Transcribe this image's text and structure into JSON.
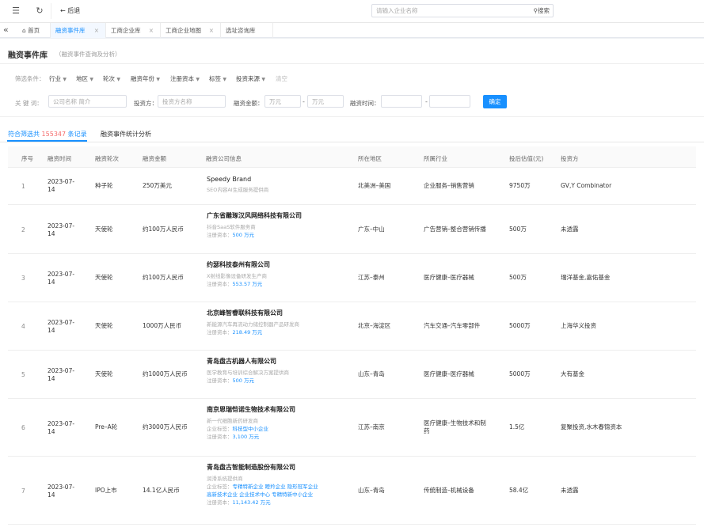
{
  "topbar": {
    "back_label": "后退",
    "search_placeholder": "请输入企业名称",
    "search_button": "搜索"
  },
  "tabs": [
    {
      "label": "首页",
      "closable": false
    },
    {
      "label": "融资事件库",
      "closable": true,
      "active": true
    },
    {
      "label": "工商企业库",
      "closable": true
    },
    {
      "label": "工商企业地图",
      "closable": true
    },
    {
      "label": "选址咨询库",
      "closable": false
    }
  ],
  "page": {
    "title": "融资事件库",
    "subtitle": "（融资事件查询及分析）"
  },
  "filters": {
    "label": "筛选条件：",
    "items": [
      "行业",
      "地区",
      "轮次",
      "融资年份",
      "注册资本",
      "标签",
      "投资来源"
    ],
    "clear": "清空"
  },
  "keyword": {
    "label": "关 键 词：",
    "company_placeholder": "公司名称 简介",
    "investor_label": "投资方：",
    "investor_placeholder": "投资方名称",
    "amount_label": "融资金额：",
    "amount_min_placeholder": "万元",
    "amount_max_placeholder": "万元",
    "dash": "-",
    "time_label": "融资时间：",
    "confirm": "确定"
  },
  "stats": {
    "prefix": "符合筛选共",
    "count": "155347",
    "suffix": "条记录",
    "analysis_tab": "融资事件统计分析"
  },
  "columns": [
    "序号",
    "融资时间",
    "融资轮次",
    "融资金额",
    "融资公司信息",
    "所在地区",
    "所属行业",
    "投后估值(元)",
    "投资方"
  ],
  "rows": [
    {
      "seq": "1",
      "date1": "2023-07-",
      "date2": "14",
      "round": "种子轮",
      "amount": "250万美元",
      "company": "Speedy Brand",
      "desc": "SEO内容AI生成服务提供商",
      "region": "北美洲–美国",
      "industry1": "企业服务–销售营销",
      "industry2": "",
      "valuation": "9750万",
      "investor": "GV,Y Combinator"
    },
    {
      "seq": "2",
      "date1": "2023-07-",
      "date2": "14",
      "round": "天使轮",
      "amount": "约100万人民币",
      "company": "广东省雕琢汉风网络科技有限公司",
      "desc": "抖音SaaS软件服务商",
      "cap_label": "注册资本：",
      "cap_value": "500 万元",
      "region": "广东–中山",
      "industry1": "广告营销–整合营销传播",
      "industry2": "",
      "valuation": "500万",
      "investor": "未透露"
    },
    {
      "seq": "3",
      "date1": "2023-07-",
      "date2": "14",
      "round": "天使轮",
      "amount": "约100万人民币",
      "company": "约瑟科技泰州有限公司",
      "desc": "X射线影像设备研发生产商",
      "cap_label": "注册资本：",
      "cap_value": "553.57 万元",
      "region": "江苏–泰州",
      "industry1": "医疗健康–医疗器械",
      "industry2": "",
      "valuation": "500万",
      "investor": "瑞洋基金,嘉佑基金"
    },
    {
      "seq": "4",
      "date1": "2023-07-",
      "date2": "14",
      "round": "天使轮",
      "amount": "1000万人民币",
      "company": "北京峰智睿联科技有限公司",
      "desc": "新能源汽车再流动力储控制器产品研发商",
      "cap_label": "注册资本：",
      "cap_value": "218.49 万元",
      "region": "北京–海淀区",
      "industry1": "汽车交通–汽车零部件",
      "industry2": "",
      "valuation": "5000万",
      "investor": "上海华义投资"
    },
    {
      "seq": "5",
      "date1": "2023-07-",
      "date2": "14",
      "round": "天使轮",
      "amount": "约1000万人民币",
      "company": "青岛盘古机器人有限公司",
      "desc": "医学教育与培训综合解决方案提供商",
      "cap_label": "注册资本：",
      "cap_value": "500 万元",
      "region": "山东–青岛",
      "industry1": "医疗健康–医疗器械",
      "industry2": "",
      "valuation": "5000万",
      "investor": "大有基金"
    },
    {
      "seq": "6",
      "date1": "2023-07-",
      "date2": "14",
      "round": "Pre–A轮",
      "amount": "约3000万人民币",
      "company": "南京恩瑞恺诺生物技术有限公司",
      "desc": "新一代细胞新药研发商",
      "tag_label": "企业标签：",
      "tags": [
        "科技型中小企业"
      ],
      "cap_label": "注册资本：",
      "cap_value": "3,100 万元",
      "region": "江苏–南京",
      "industry1": "医疗健康–生物技术和制",
      "industry2": "药",
      "valuation": "1.5亿",
      "investor": "复聚投资,水木春锦资本"
    },
    {
      "seq": "7",
      "date1": "2023-07-",
      "date2": "14",
      "round": "IPO上市",
      "amount": "14.1亿人民币",
      "company": "青岛盘古智能制造股份有限公司",
      "desc": "润滑系统提供商",
      "tag_label": "企业标签：",
      "tags": [
        "专精特新企业",
        "瞪羚企业",
        "隐形冠军企业",
        "高新技术企业",
        "企业技术中心",
        "专精特新中小企业"
      ],
      "cap_label": "注册资本：",
      "cap_value": "11,143.42 万元",
      "region": "山东–青岛",
      "industry1": "传统制造–机械设备",
      "industry2": "",
      "valuation": "58.4亿",
      "investor": "未透露"
    }
  ]
}
